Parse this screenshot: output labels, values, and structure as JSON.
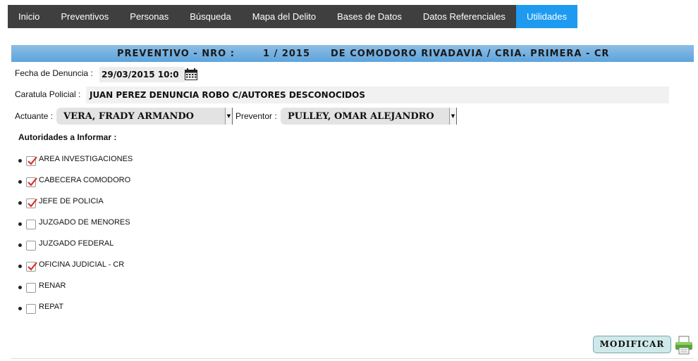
{
  "nav": {
    "items": [
      "Inicio",
      "Preventivos",
      "Personas",
      "Búsqueda",
      "Mapa del Delito",
      "Bases de Datos",
      "Datos Referenciales",
      "Utilidades"
    ]
  },
  "banner": {
    "label": "PREVENTIVO - NRO :",
    "number": "1  /  2015",
    "location": "DE COMODORO RIVADAVIA / CRIA. PRIMERA - CR"
  },
  "form": {
    "fecha_label": "Fecha de Denuncia :",
    "fecha_value": "29/03/2015 10:0",
    "caratula_label": "Caratula Policial :",
    "caratula_value": "JUAN PEREZ DENUNCIA ROBO C/AUTORES DESCONOCIDOS",
    "actuante_label": "Actuante :",
    "actuante_value": "VERA, FRADY ARMANDO",
    "preventor_label": "Preventor :",
    "preventor_value": "PULLEY, OMAR ALEJANDRO"
  },
  "autoridades": {
    "title": "Autoridades a Informar :",
    "items": [
      {
        "label": "AREA INVESTIGACIONES",
        "checked": true
      },
      {
        "label": "CABECERA COMODORO",
        "checked": true
      },
      {
        "label": "JEFE DE POLICIA",
        "checked": true
      },
      {
        "label": "JUZGADO DE MENORES",
        "checked": false
      },
      {
        "label": "JUZGADO FEDERAL",
        "checked": false
      },
      {
        "label": "OFICINA JUDICIAL - CR",
        "checked": true
      },
      {
        "label": "RENAR",
        "checked": false
      },
      {
        "label": "REPAT",
        "checked": false
      }
    ]
  },
  "actions": {
    "modify_label": "MODIFICAR",
    "print_icon": "printer-icon"
  },
  "colors": {
    "nav_bg": "#3f3f3f",
    "nav_active": "#1e9bf0",
    "banner": "#6fb0e0",
    "check": "#d9302c"
  }
}
